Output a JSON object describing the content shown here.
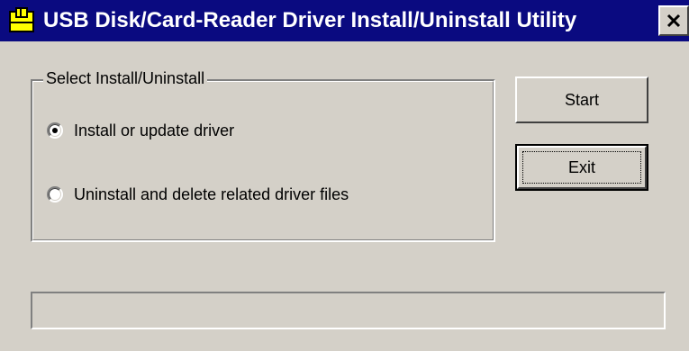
{
  "window": {
    "title": "USB Disk/Card-Reader Driver Install/Uninstall Utility",
    "icons": {
      "app": "usb-driver-icon",
      "close": "close-icon"
    },
    "colors": {
      "titlebar": "#0a0a80",
      "face": "#d4d0c8",
      "title_text": "#ffffff"
    }
  },
  "group": {
    "legend": "Select Install/Uninstall",
    "options": [
      {
        "label": "Install or update driver",
        "checked": true
      },
      {
        "label": "Uninstall and delete related driver files",
        "checked": false
      }
    ]
  },
  "buttons": {
    "start_label": "Start",
    "exit_label": "Exit"
  },
  "status": {
    "text": ""
  }
}
